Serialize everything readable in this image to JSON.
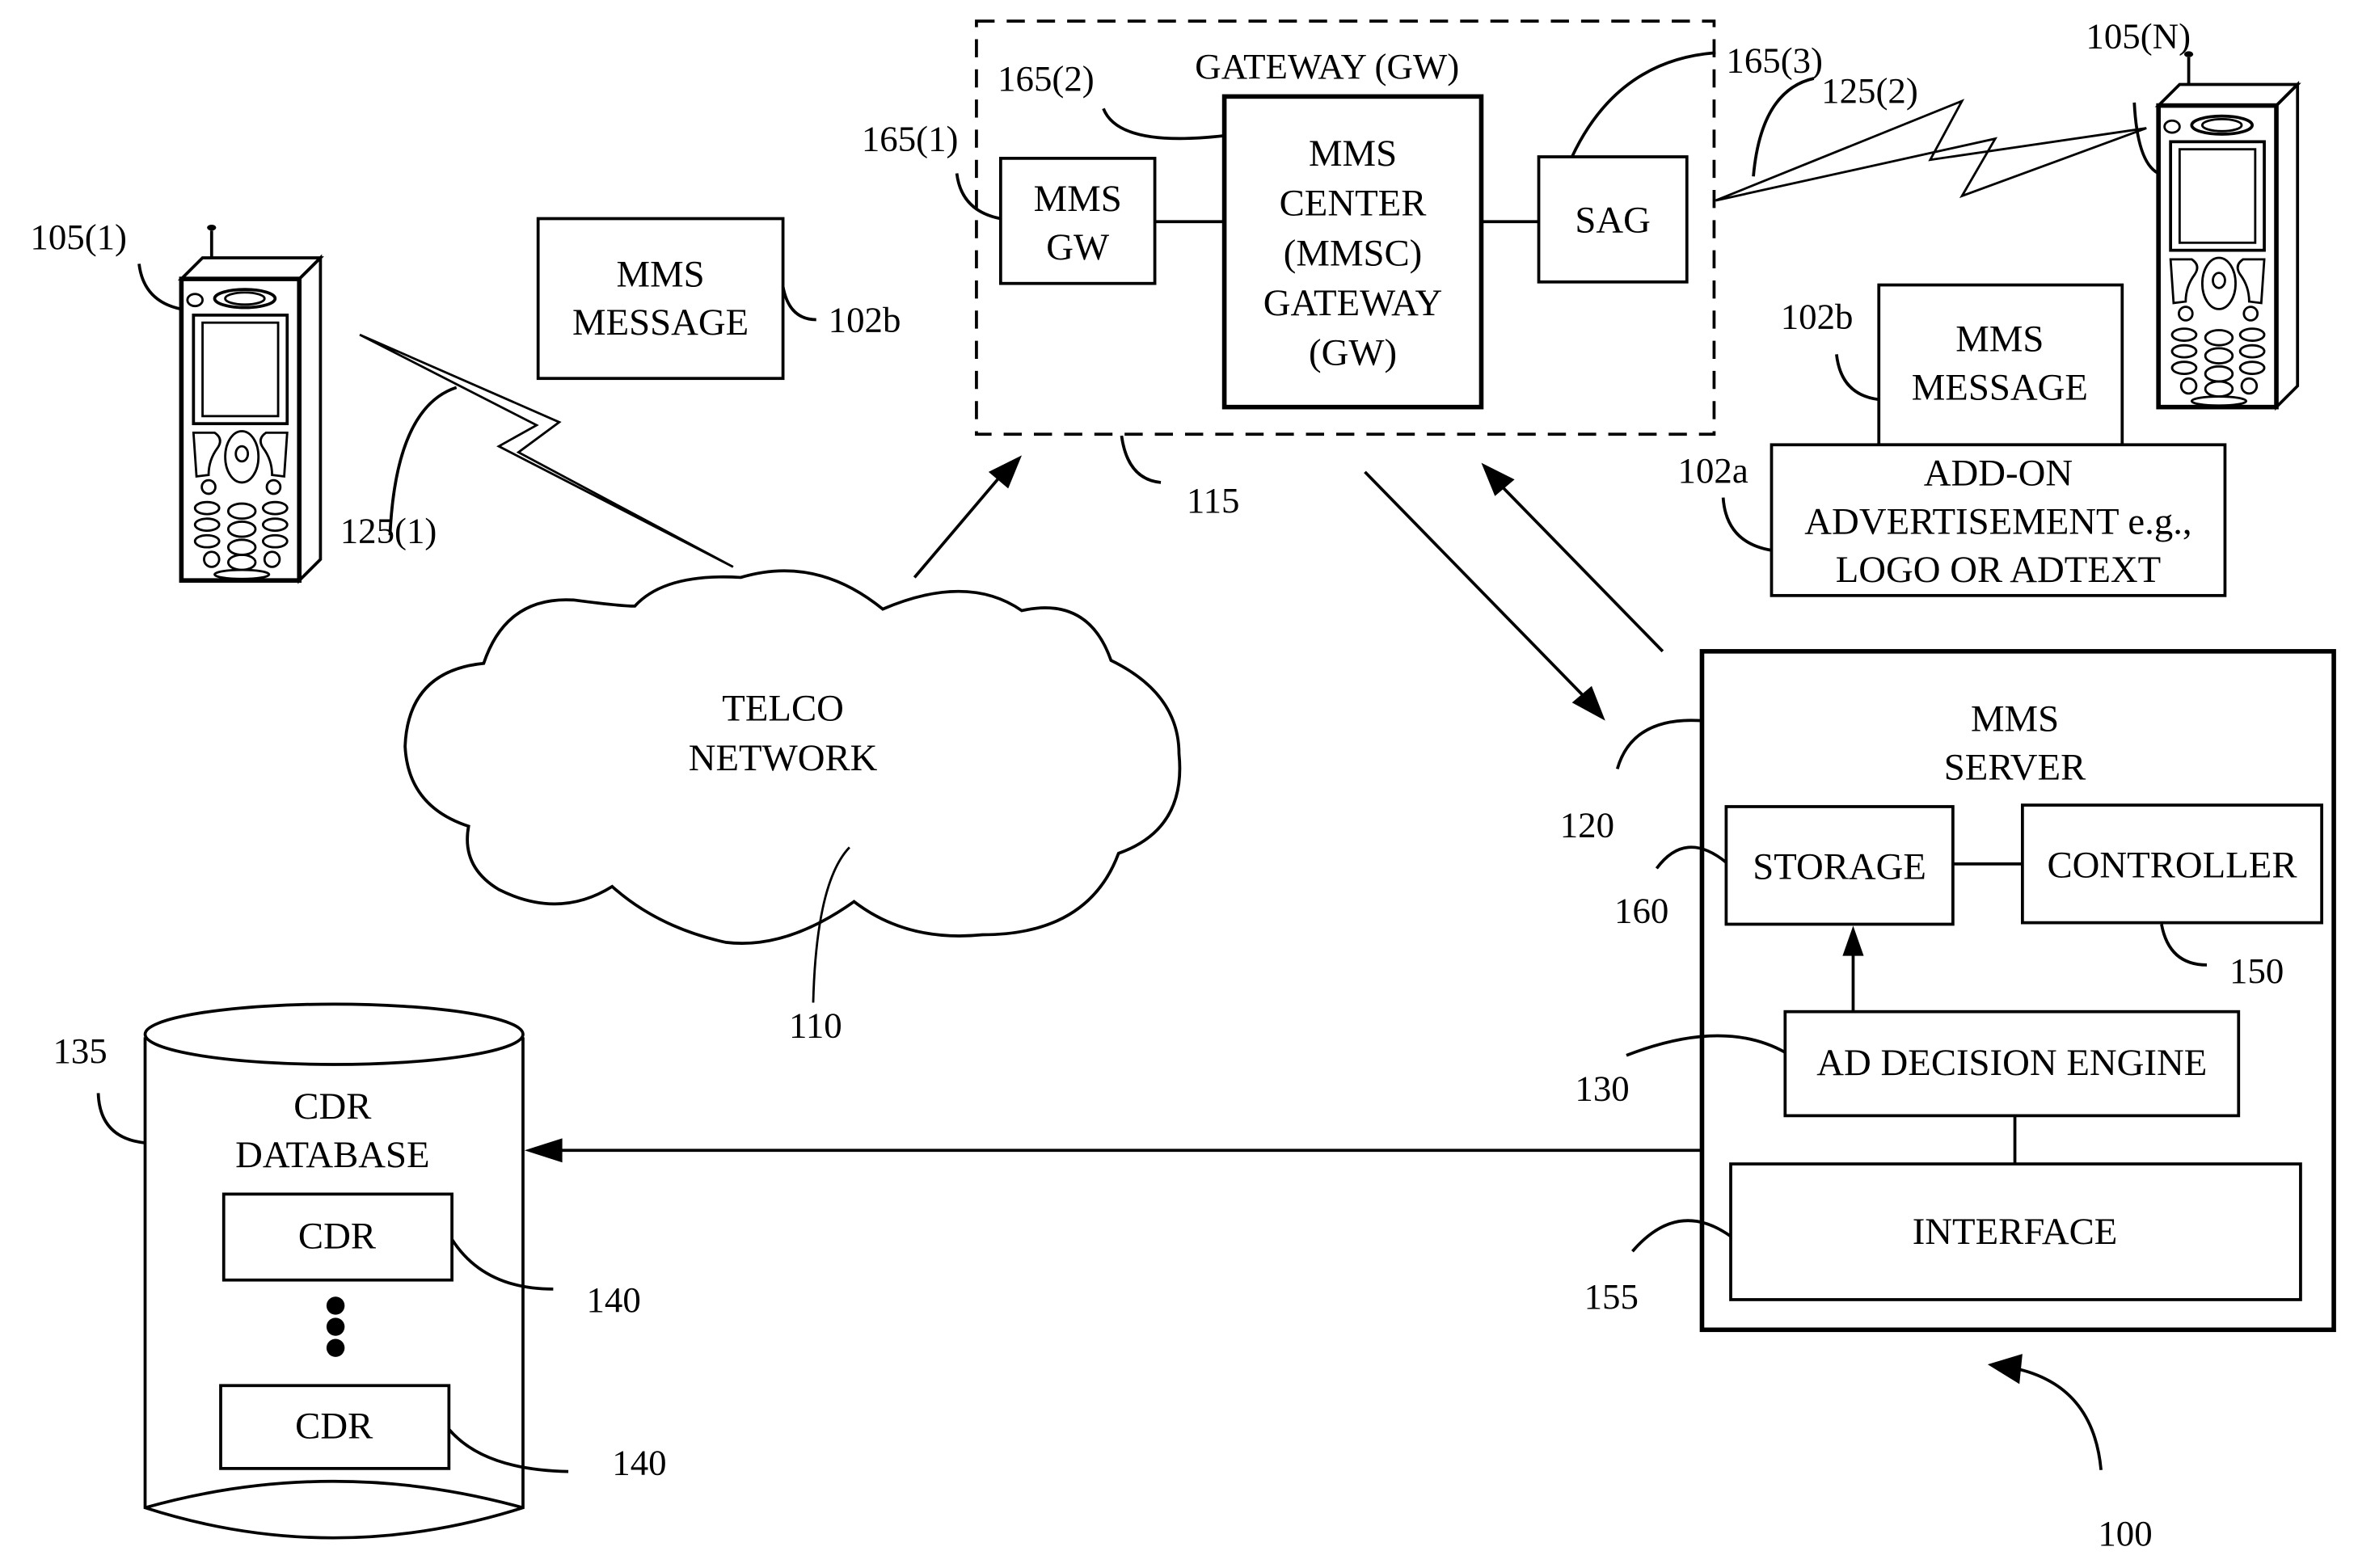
{
  "diagram": {
    "figure_number": "100",
    "phones": [
      {
        "ref": "105(1)",
        "link_ref": "125(1)"
      },
      {
        "ref": "105(N)",
        "link_ref": "125(2)"
      }
    ],
    "mms_message_left": {
      "lines": [
        "MMS",
        "MESSAGE"
      ],
      "ref": "102b"
    },
    "gateway": {
      "title": "GATEWAY (GW)",
      "ref": "115",
      "mms_gw": {
        "lines": [
          "MMS",
          "GW"
        ],
        "ref": "165(1)"
      },
      "mmsc": {
        "lines": [
          "MMS",
          "CENTER",
          "(MMSC)",
          "GATEWAY",
          "(GW)"
        ],
        "ref": "165(2)"
      },
      "sag": {
        "label": "SAG",
        "ref": "165(3)"
      }
    },
    "mms_message_right": {
      "lines": [
        "MMS",
        "MESSAGE"
      ],
      "ref": "102b"
    },
    "addon": {
      "lines": [
        "ADD-ON",
        "ADVERTISEMENT e.g.,",
        "LOGO OR ADTEXT"
      ],
      "ref": "102a"
    },
    "telco": {
      "lines": [
        "TELCO",
        "NETWORK"
      ],
      "ref": "110"
    },
    "server": {
      "lines": [
        "MMS",
        "SERVER"
      ],
      "ref": "120",
      "storage": {
        "label": "STORAGE",
        "ref": "160"
      },
      "controller": {
        "label": "CONTROLLER",
        "ref": "150"
      },
      "ad_engine": {
        "label": "AD DECISION ENGINE",
        "ref": "130"
      },
      "interface": {
        "label": "INTERFACE",
        "ref": "155"
      }
    },
    "database": {
      "lines": [
        "CDR",
        "DATABASE"
      ],
      "ref": "135",
      "records": [
        {
          "label": "CDR",
          "ref": "140"
        },
        {
          "label": "CDR",
          "ref": "140"
        }
      ]
    }
  }
}
